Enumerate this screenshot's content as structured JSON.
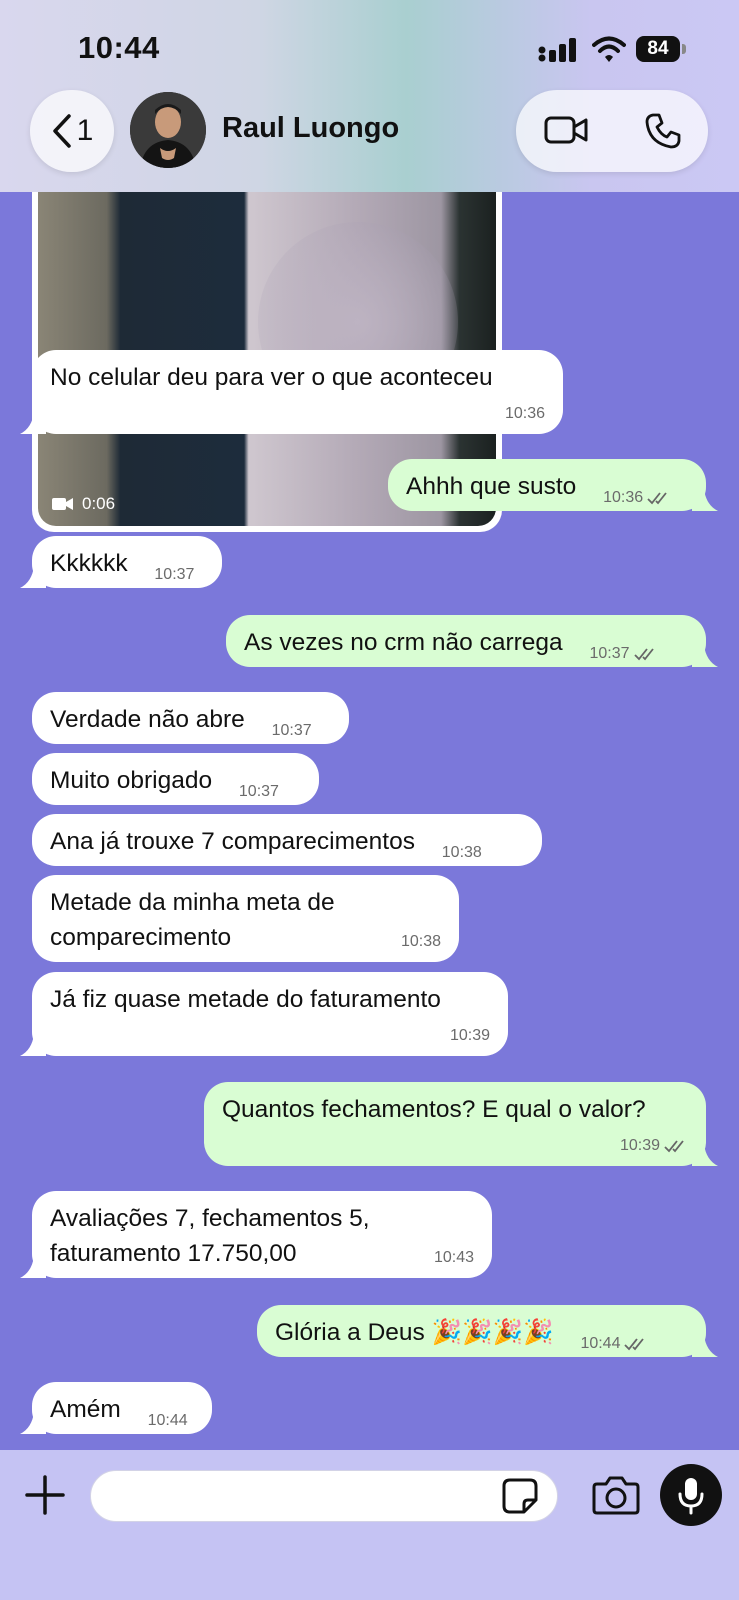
{
  "status_bar": {
    "time": "10:44",
    "battery": "84"
  },
  "header": {
    "back_count": "1",
    "contact_name": "Raul Luongo"
  },
  "video_message": {
    "duration": "0:06",
    "time": "10:36"
  },
  "messages": [
    {
      "direction": "in",
      "text": "No celular deu para ver o que aconteceu",
      "time": "10:36"
    },
    {
      "direction": "out",
      "text": "Ahhh que susto",
      "time": "10:36"
    },
    {
      "direction": "in",
      "text": "Kkkkkk",
      "time": "10:37"
    },
    {
      "direction": "out",
      "text": "As vezes no crm não carrega",
      "time": "10:37"
    },
    {
      "direction": "in",
      "text": "Verdade não abre",
      "time": "10:37"
    },
    {
      "direction": "in",
      "text": "Muito obrigado",
      "time": "10:37"
    },
    {
      "direction": "in",
      "text": "Ana já trouxe 7 comparecimentos",
      "time": "10:38"
    },
    {
      "direction": "in",
      "line1": "Metade da minha meta de",
      "line2": "comparecimento",
      "time": "10:38"
    },
    {
      "direction": "in",
      "text": "Já fiz quase metade do faturamento",
      "time": "10:39"
    },
    {
      "direction": "out",
      "text": "Quantos fechamentos? E qual o valor?",
      "time": "10:39"
    },
    {
      "direction": "in",
      "line1": "Avaliações 7, fechamentos 5,",
      "line2": "faturamento 17.750,00",
      "time": "10:43"
    },
    {
      "direction": "out",
      "text": "Glória a Deus 🎉🎉🎉🎉",
      "time": "10:44"
    },
    {
      "direction": "in",
      "text": "Amém",
      "time": "10:44"
    }
  ],
  "composer": {
    "placeholder": ""
  },
  "colors": {
    "chat_background": "#7b78da",
    "incoming_bubble": "#ffffff",
    "outgoing_bubble": "#d9fdd3",
    "bottom_bar": "#c5c3f3"
  },
  "icons": [
    "back-chevron-icon",
    "video-call-icon",
    "phone-icon",
    "video-camera-icon",
    "read-ticks-icon",
    "plus-icon",
    "sticker-icon",
    "camera-icon",
    "microphone-icon"
  ]
}
